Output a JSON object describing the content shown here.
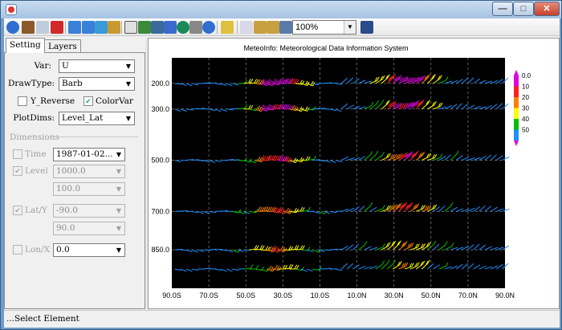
{
  "window": {
    "title": ""
  },
  "toolbar": {
    "zoom_value": "100%"
  },
  "tabs": [
    {
      "label": "Setting"
    },
    {
      "label": "Layers"
    }
  ],
  "setting": {
    "var_label": "Var:",
    "var_value": "U",
    "drawtype_label": "DrawType:",
    "drawtype_value": "Barb",
    "y_reverse_label": "Y_Reverse",
    "y_reverse_checked": false,
    "colorvar_label": "ColorVar",
    "colorvar_checked": true,
    "plotdims_label": "PlotDims:",
    "plotdims_value": "Level_Lat"
  },
  "dimensions": {
    "header": "Dimensions",
    "time_label": "Time",
    "time_value": "1987-01-02...",
    "level_label": "Level",
    "level_value_1": "1000.0",
    "level_value_2": "100.0",
    "lat_label": "Lat/Y",
    "lat_value_1": "-90.0",
    "lat_value_2": "90.0",
    "lon_label": "Lon/X",
    "lon_value": "0.0"
  },
  "plot": {
    "title": "MeteoInfo: Meteorological Data Information System",
    "y_ticks": [
      "200.0",
      "300.0",
      "500.0",
      "700.0",
      "850.0"
    ],
    "x_ticks": [
      "90.0S",
      "70.0S",
      "50.0S",
      "30.0S",
      "10.0S",
      "10.0N",
      "30.0N",
      "50.0N",
      "70.0N",
      "90.0N"
    ],
    "legend": [
      {
        "label": "0.0",
        "color": "#1e90ff"
      },
      {
        "label": "10",
        "color": "#00c000"
      },
      {
        "label": "20",
        "color": "#ffff00"
      },
      {
        "label": "30",
        "color": "#ff8000"
      },
      {
        "label": "40",
        "color": "#ff2020"
      },
      {
        "label": "50",
        "color": "#e000e0"
      }
    ]
  },
  "status": {
    "text": "...Select Element"
  }
}
